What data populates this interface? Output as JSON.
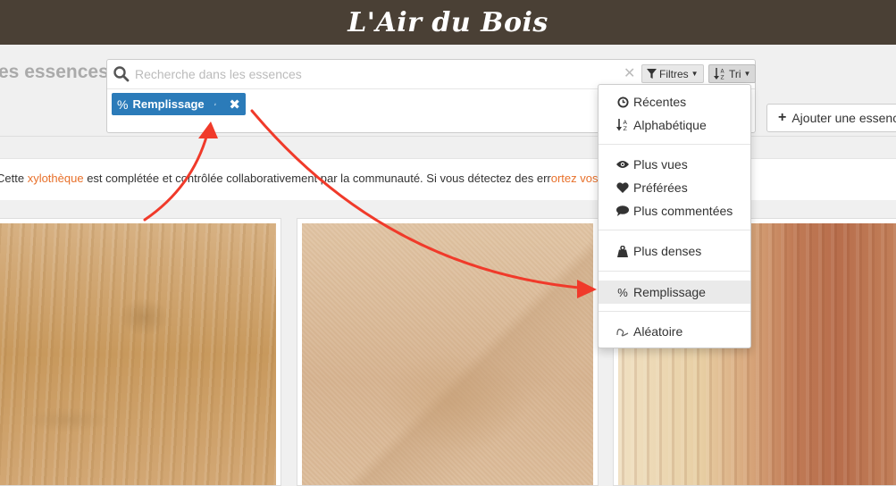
{
  "header": {
    "brand": "L'Air du Bois"
  },
  "page": {
    "title": "es essences"
  },
  "search": {
    "placeholder": "Recherche dans les essences",
    "filters_label": "Filtres",
    "sort_label": "Tri"
  },
  "active_filter": {
    "label": "Remplissage"
  },
  "toolbar": {
    "add_label": "Ajouter une essence"
  },
  "notice": {
    "before": "Cette ",
    "link1": "xylothèque",
    "middle": " est complétée et contrôlée collaborativement par la communauté. Si vous détectez des err",
    "link2": "ortez vos propositions",
    "after": " !"
  },
  "sort_menu": {
    "items": [
      {
        "label": "Récentes",
        "icon": "clock-icon"
      },
      {
        "label": "Alphabétique",
        "icon": "sort-alpha-icon"
      },
      {
        "label": "Plus vues",
        "icon": "eye-icon"
      },
      {
        "label": "Préférées",
        "icon": "heart-icon"
      },
      {
        "label": "Plus commentées",
        "icon": "comment-icon"
      },
      {
        "label": "Plus denses",
        "icon": "weight-icon"
      },
      {
        "label": "Remplissage",
        "icon": "percent-icon",
        "active": true
      },
      {
        "label": "Aléatoire",
        "icon": "random-icon"
      }
    ]
  },
  "colors": {
    "header_bg": "#4a4035",
    "chip_bg": "#2b7bb9",
    "link": "#e8702a",
    "annotation_arrow": "#f03a2a"
  }
}
